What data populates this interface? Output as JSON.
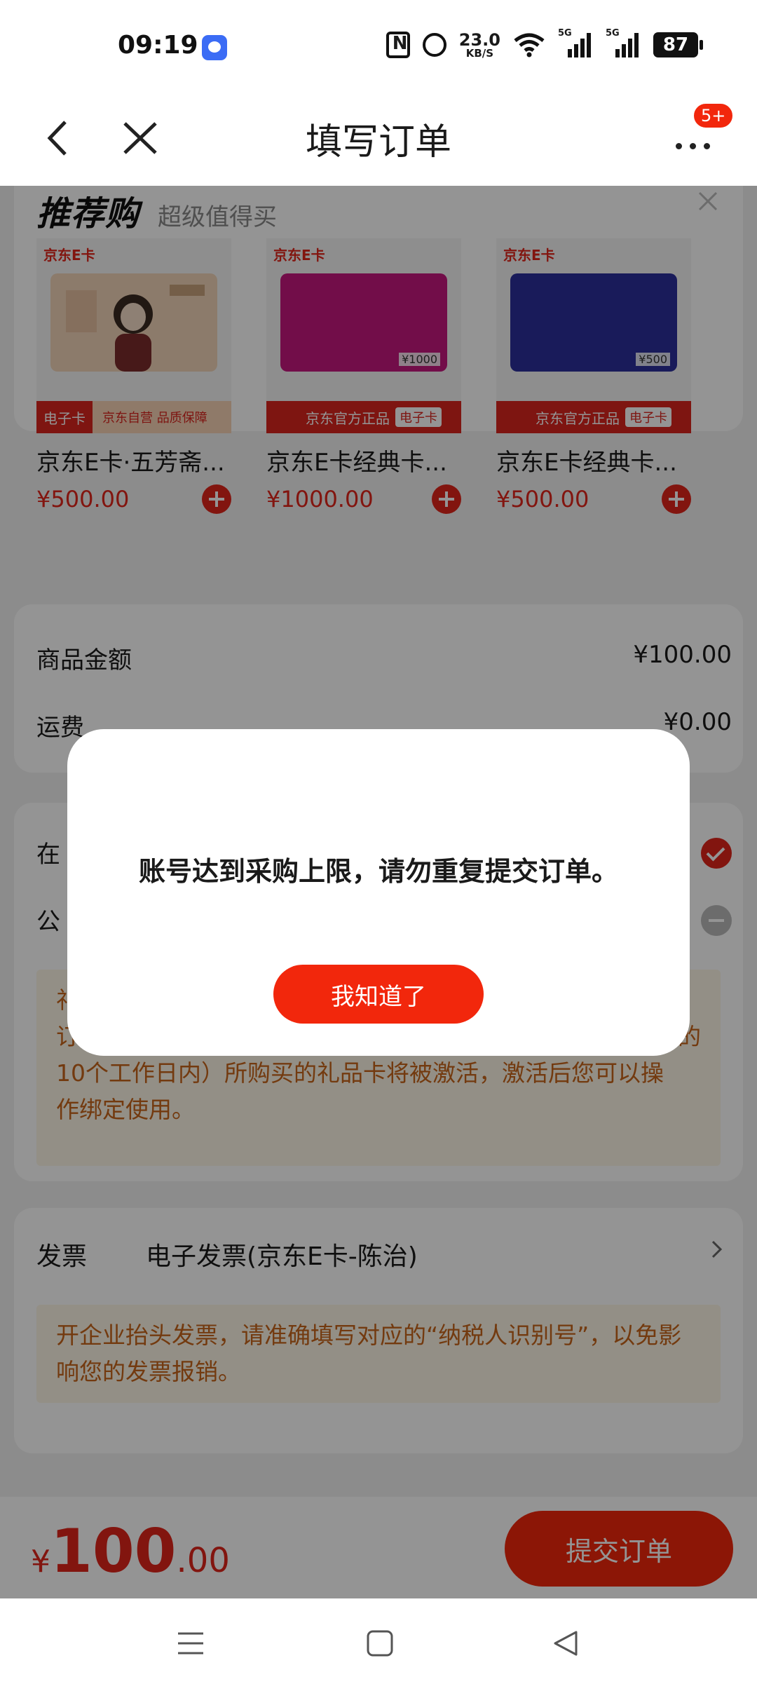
{
  "status_bar": {
    "time": "09:19",
    "net_speed_value": "23.0",
    "net_speed_unit": "KB/S",
    "signal1_tag": "5G",
    "signal2_tag": "5G",
    "battery": "87"
  },
  "title_bar": {
    "title": "填写订单",
    "badge": "5+"
  },
  "recommend": {
    "logo": "推荐购",
    "subtitle": "超级值得买",
    "products": [
      {
        "brand": "京东E卡",
        "name": "京东E卡·五芳斋...",
        "price": "¥500.00",
        "card_value": "",
        "ribbon": "京东自营 品质保障",
        "ribbon_pill": "",
        "left_tag": "电子卡",
        "color": "#f3d9c2"
      },
      {
        "brand": "京东E卡",
        "name": "京东E卡经典卡...",
        "price": "¥1000.00",
        "card_value": "¥1000",
        "ribbon": "京东官方正品",
        "ribbon_pill": "电子卡",
        "left_tag": "",
        "color": "#c4177e"
      },
      {
        "brand": "京东E卡",
        "name": "京东E卡经典卡...",
        "price": "¥500.00",
        "card_value": "¥500",
        "ribbon": "京东官方正品",
        "ribbon_pill": "电子卡",
        "left_tag": "",
        "color": "#2b2f9c"
      }
    ]
  },
  "amounts": {
    "goods_label": "商品金额",
    "goods_value": "¥100.00",
    "shipping_label": "运费",
    "shipping_value": "¥0.00"
  },
  "payment": {
    "row1_label": "在",
    "row2_label": "公",
    "notice_line1": "礼",
    "notice_line2": "订",
    "notice_line2_end": "的",
    "notice_line3": "10个工作日内）所购买的礼品卡将被激活，激活后您可以操",
    "notice_line4": "作绑定使用。"
  },
  "invoice": {
    "label": "发票",
    "value": "电子发票(京东E卡-陈治)",
    "notice": "开企业抬头发票，请准确填写对应的“纳税人识别号”，以免影响您的发票报销。"
  },
  "bottom_bar": {
    "price_symbol": "¥",
    "price_integer": "100",
    "price_decimal": ".00",
    "submit_label": "提交订单"
  },
  "dialog": {
    "message": "账号达到采购上限，请勿重复提交订单。",
    "confirm_label": "我知道了"
  },
  "colors": {
    "accent": "#f2270c",
    "price_red": "#e1251b",
    "notice_text": "#c7651a",
    "notice_bg": "#fdf6e7"
  }
}
